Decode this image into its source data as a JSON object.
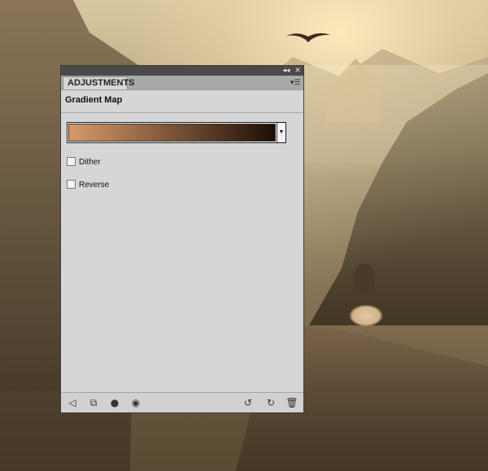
{
  "window": {
    "collapse_glyph": "◂◂",
    "close_glyph": "✕"
  },
  "panel": {
    "tab_label": "ADJUSTMENTS",
    "menu_glyph": "▾☰",
    "adjustment_title": "Gradient Map",
    "gradient": {
      "start_color": "#d79a69",
      "end_color": "#1e0e06",
      "arrow_glyph": "▼"
    },
    "options": [
      {
        "label": "Dither",
        "checked": false
      },
      {
        "label": "Reverse",
        "checked": false
      }
    ]
  },
  "footer": {
    "icons": [
      {
        "name": "back-arrow-icon",
        "glyph": "◁"
      },
      {
        "name": "clip-to-layer-icon",
        "glyph": "⧉"
      },
      {
        "name": "view-previous-state-icon",
        "glyph": "●"
      },
      {
        "name": "toggle-visibility-icon",
        "glyph": "◉"
      },
      {
        "name": "reset-icon",
        "glyph": "↺"
      },
      {
        "name": "refresh-icon",
        "glyph": "↻"
      },
      {
        "name": "delete-icon",
        "glyph": "🗑"
      }
    ]
  }
}
